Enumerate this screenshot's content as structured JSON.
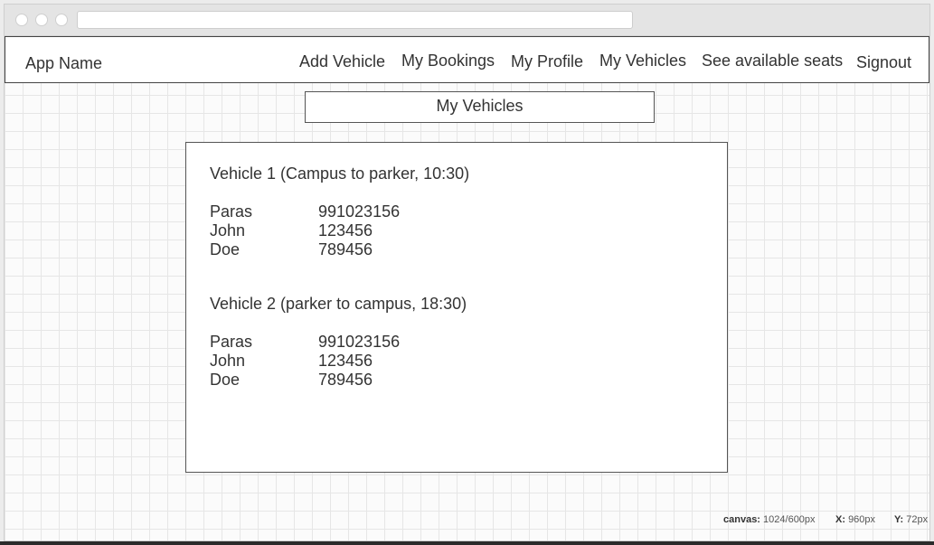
{
  "navbar": {
    "brand": "App Name",
    "links": [
      "Add Vehicle",
      "My Bookings",
      "My Profile",
      "My Vehicles",
      "See available seats",
      "Signout"
    ]
  },
  "page": {
    "title": "My Vehicles"
  },
  "vehicles": [
    {
      "title": "Vehicle 1 (Campus to parker, 10:30)",
      "riders": [
        {
          "name": "Paras",
          "phone": "991023156"
        },
        {
          "name": "John",
          "phone": "123456"
        },
        {
          "name": "Doe",
          "phone": "789456"
        }
      ]
    },
    {
      "title": "Vehicle 2 (parker to campus, 18:30)",
      "riders": [
        {
          "name": "Paras",
          "phone": "991023156"
        },
        {
          "name": "John",
          "phone": "123456"
        },
        {
          "name": "Doe",
          "phone": "789456"
        }
      ]
    }
  ],
  "canvas_info": {
    "canvas_label": "canvas:",
    "canvas_value": "1024/600px",
    "x_label": "X:",
    "x_value": "960px",
    "y_label": "Y:",
    "y_value": "72px"
  }
}
